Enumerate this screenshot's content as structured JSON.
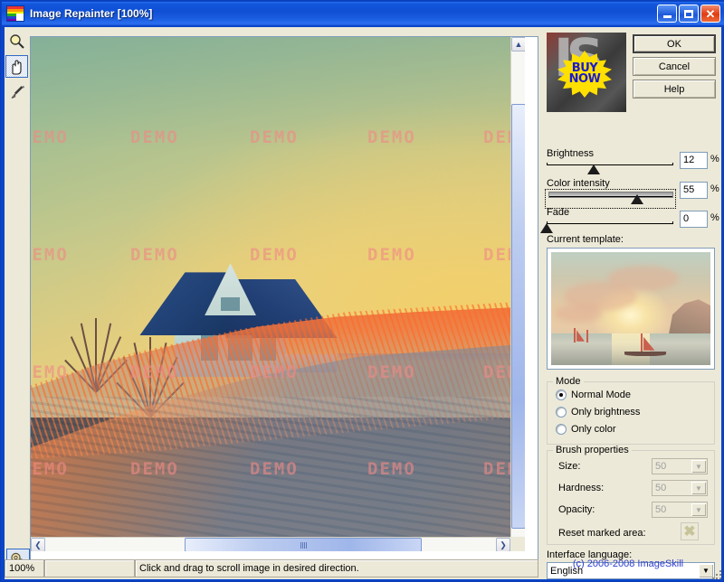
{
  "window": {
    "title": "Image Repainter [100%]",
    "icon": "rainbow-icon",
    "minimize": "minimize-icon",
    "maximize": "maximize-icon",
    "close": "close-icon"
  },
  "toolbar": {
    "tools": [
      {
        "name": "zoom-tool",
        "icon": "magnifier-icon",
        "selected": false
      },
      {
        "name": "pan-tool",
        "icon": "hand-icon",
        "selected": true
      },
      {
        "name": "brush-tool",
        "icon": "brush-icon",
        "selected": false
      }
    ],
    "settings": {
      "name": "settings-tool",
      "icon": "gears-icon"
    }
  },
  "canvas": {
    "watermark_text": "DEMO",
    "scroll": {
      "up": "▲",
      "down": "▼",
      "left": "❮",
      "right": "❯"
    }
  },
  "panel": {
    "logo": {
      "letters": "IS",
      "badge_line1": "BUY",
      "badge_line2": "NOW"
    },
    "buttons": {
      "ok": "OK",
      "cancel": "Cancel",
      "help": "Help"
    },
    "sliders": [
      {
        "label": "Brightness",
        "value": "12",
        "unit": "%",
        "percent": 38,
        "focused": false
      },
      {
        "label": "Color intensity",
        "value": "55",
        "unit": "%",
        "percent": 72,
        "focused": true
      },
      {
        "label": "Fade",
        "value": "0",
        "unit": "%",
        "percent": 0,
        "focused": false
      }
    ],
    "template": {
      "label": "Current template:",
      "alt": "sunset-seascape-painting"
    },
    "mode": {
      "legend": "Mode",
      "options": [
        {
          "label": "Normal Mode",
          "selected": true
        },
        {
          "label": "Only brightness",
          "selected": false
        },
        {
          "label": "Only color",
          "selected": false
        }
      ]
    },
    "brush": {
      "legend": "Brush properties",
      "fields": [
        {
          "label": "Size:",
          "value": "50",
          "disabled": true
        },
        {
          "label": "Hardness:",
          "value": "50",
          "disabled": true
        },
        {
          "label": "Opacity:",
          "value": "50",
          "disabled": true
        }
      ],
      "reset_label": "Reset marked area:",
      "reset_icon": "x-icon"
    },
    "language": {
      "label": "Interface language:",
      "value": "English"
    },
    "copyright": "(c) 2006-2008 ImageSkill"
  },
  "status": {
    "zoom": "100%",
    "middle": "",
    "hint": "Click and drag to scroll image in desired direction."
  }
}
